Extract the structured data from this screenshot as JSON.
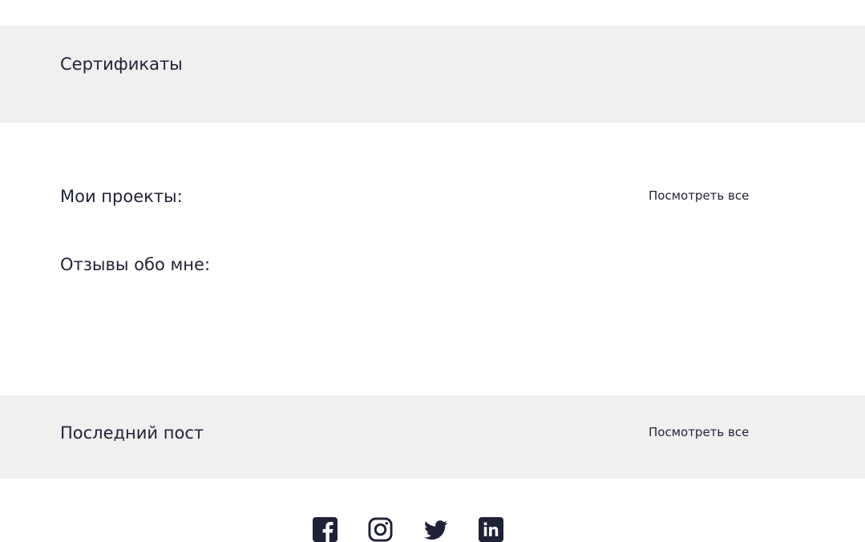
{
  "sections": {
    "certificates": {
      "title": "Сертификаты"
    },
    "projects": {
      "title": "Мои проекты:",
      "see_all": "Посмотреть все"
    },
    "reviews": {
      "title": "Отзывы обо мне:"
    },
    "last_post": {
      "title": "Последний пост",
      "see_all": "Посмотреть все"
    }
  },
  "footer": {
    "social_icons": [
      "facebook-icon",
      "instagram-icon",
      "twitter-icon",
      "linkedin-icon"
    ]
  },
  "colors": {
    "text": "#1f2236",
    "band_bg": "#f0f0f0",
    "page_bg": "#ffffff"
  }
}
